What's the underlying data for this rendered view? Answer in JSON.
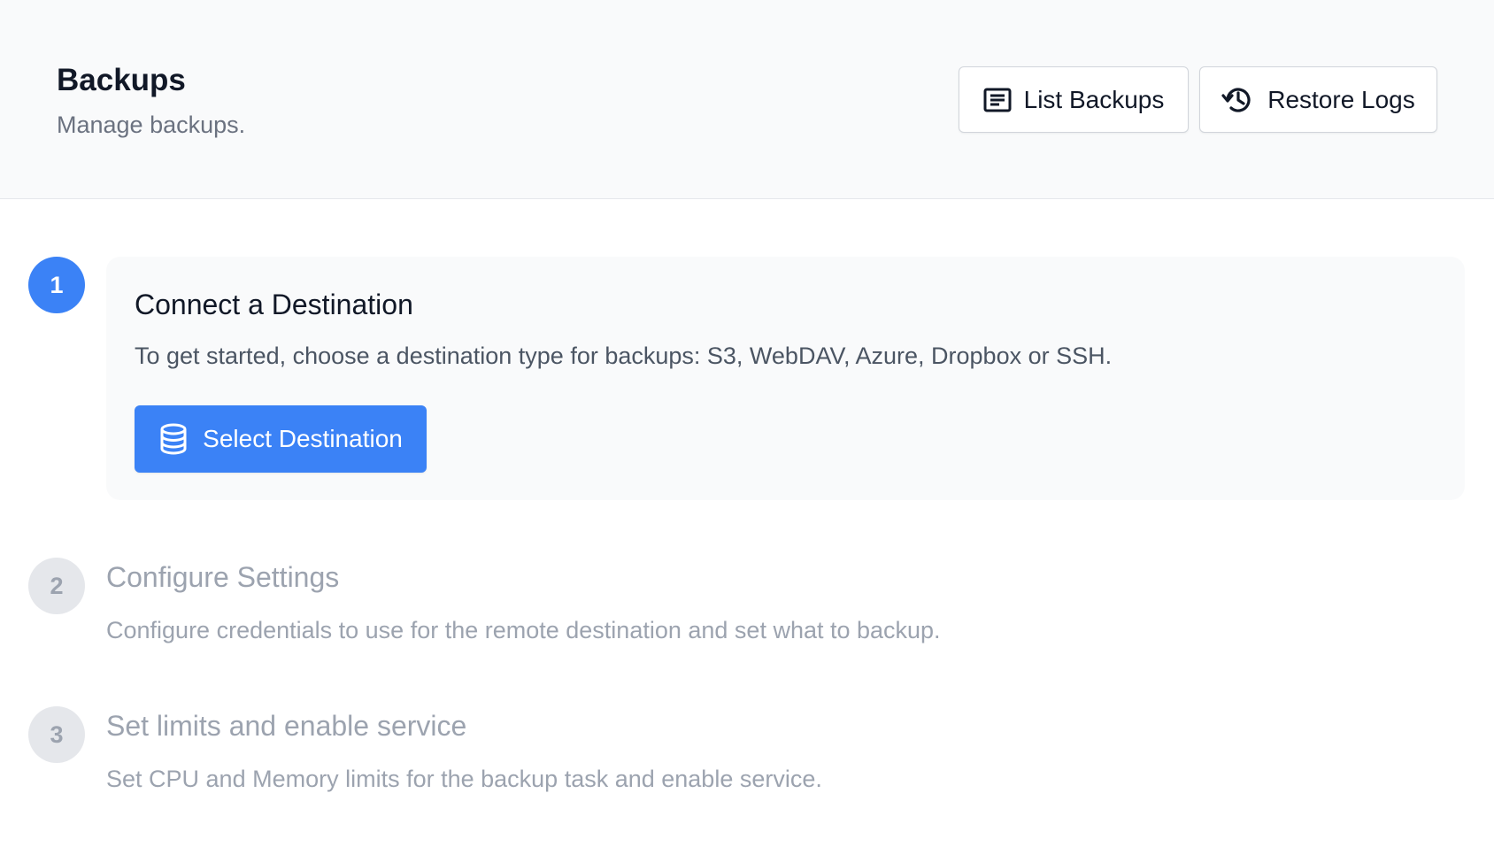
{
  "header": {
    "title": "Backups",
    "subtitle": "Manage backups.",
    "buttons": {
      "list_backups": {
        "label": "List Backups",
        "icon": "list-document-icon"
      },
      "restore_logs": {
        "label": "Restore Logs",
        "icon": "history-icon"
      }
    }
  },
  "steps": [
    {
      "number": "1",
      "state": "active",
      "title": "Connect a Destination",
      "description": "To get started, choose a destination type for backups: S3, WebDAV, Azure, Dropbox or SSH.",
      "action": {
        "label": "Select Destination",
        "icon": "database-icon"
      }
    },
    {
      "number": "2",
      "state": "inactive",
      "title": "Configure Settings",
      "description": "Configure credentials to use for the remote destination and set what to backup."
    },
    {
      "number": "3",
      "state": "inactive",
      "title": "Set limits and enable service",
      "description": "Set CPU and Memory limits for the backup task and enable service."
    }
  ],
  "colors": {
    "primary": "#3b82f6",
    "header_bg": "#f9fafb",
    "muted_text": "#9ca3af",
    "inactive_circle": "#e5e7eb"
  }
}
